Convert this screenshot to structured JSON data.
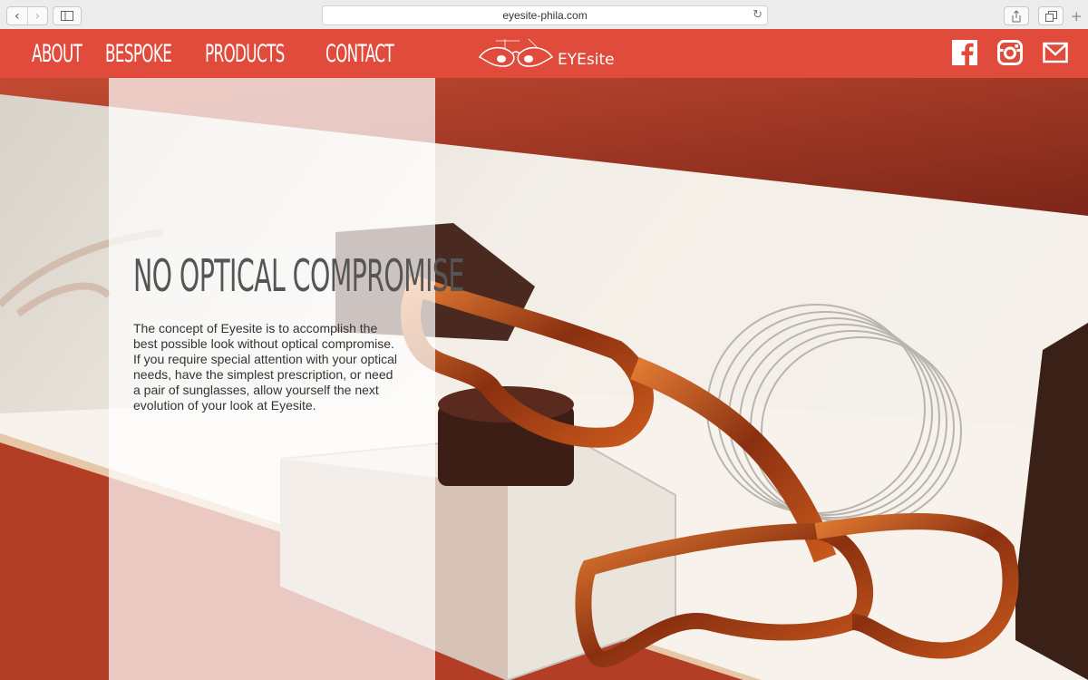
{
  "browser": {
    "url": "eyesite-phila.com",
    "back_icon": "‹",
    "forward_icon": "›",
    "reload_icon": "↻",
    "new_tab_icon": "+"
  },
  "header": {
    "menu": [
      "ABOUT",
      "BESPOKE",
      "PRODUCTS",
      "CONTACT"
    ],
    "logo_text": "EYEsite",
    "social": [
      "facebook-icon",
      "instagram-icon",
      "mail-icon"
    ],
    "bg_color": "#e04b3c"
  },
  "hero": {
    "headline": "NO OPTICAL COMPROMISE",
    "body": "The concept of Eyesite is to accomplish the best possible look without optical compromise. If you require special attention with your optical needs, have the simplest prescription, or need a pair of sunglasses, allow yourself the next evolution of your look at Eyesite."
  }
}
